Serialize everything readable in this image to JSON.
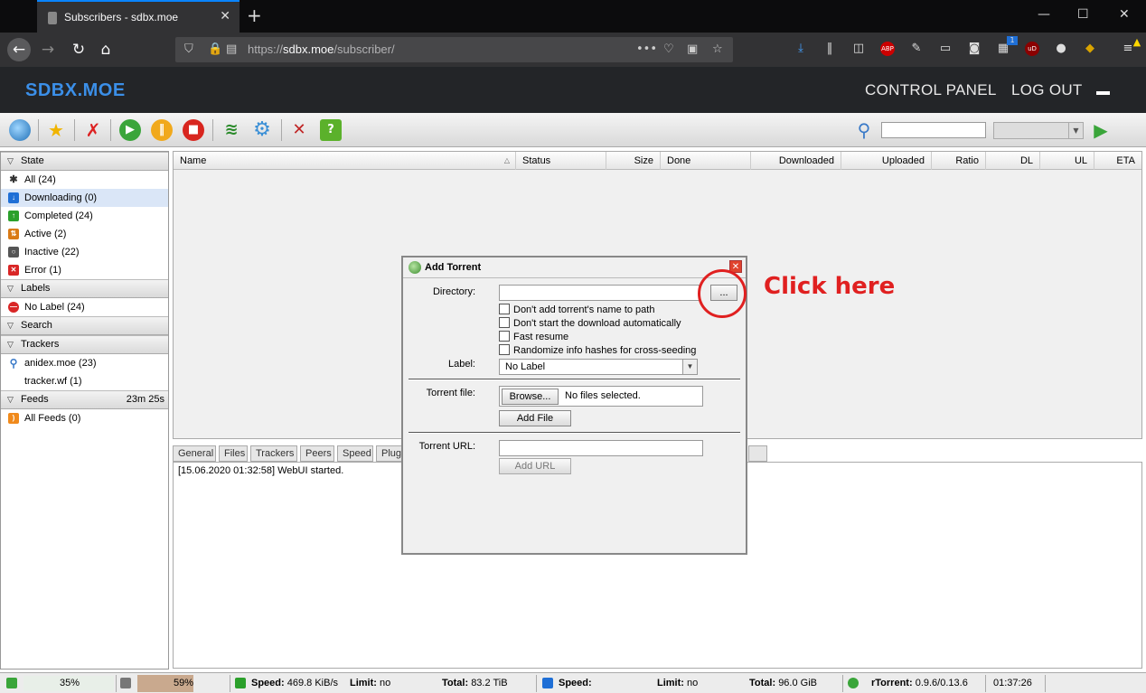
{
  "browser": {
    "tab_title": "Subscribers - sdbx.moe",
    "url_prefix": "https://",
    "url_host": "sdbx.moe",
    "url_path": "/subscriber/",
    "ext_badge": "1"
  },
  "site": {
    "logo": "SDBX.MOE",
    "nav": [
      "CONTROL PANEL",
      "LOG OUT"
    ]
  },
  "sidebar": {
    "state_header": "State",
    "state_items": [
      {
        "label": "All (24)",
        "icon": "all-icon",
        "color": "#333333"
      },
      {
        "label": "Downloading (0)",
        "icon": "download-arrow-icon",
        "color": "#1f6fd6"
      },
      {
        "label": "Completed (24)",
        "icon": "upload-arrow-icon",
        "color": "#2ba02b"
      },
      {
        "label": "Active (2)",
        "icon": "active-icon",
        "color": "#d97a16"
      },
      {
        "label": "Inactive (22)",
        "icon": "inactive-icon",
        "color": "#555555"
      },
      {
        "label": "Error (1)",
        "icon": "error-icon",
        "color": "#d92626"
      }
    ],
    "labels_header": "Labels",
    "label_items": [
      {
        "label": "No Label (24)"
      }
    ],
    "search_header": "Search",
    "trackers_header": "Trackers",
    "tracker_items": [
      {
        "label": "anidex.moe (23)"
      },
      {
        "label": "tracker.wf (1)"
      }
    ],
    "feeds_header": "Feeds",
    "feeds_time": "23m 25s",
    "feed_items": [
      {
        "label": "All Feeds (0)"
      }
    ]
  },
  "table": {
    "columns": [
      "Name",
      "Status",
      "Size",
      "Done",
      "Downloaded",
      "Uploaded",
      "Ratio",
      "DL",
      "UL",
      "ETA"
    ]
  },
  "bottom_tabs": [
    "General",
    "Files",
    "Trackers",
    "Peers",
    "Speed",
    "Plug"
  ],
  "log": [
    "[15.06.2020 01:32:58] WebUI started."
  ],
  "dialog": {
    "title": "Add Torrent",
    "directory_label": "Directory:",
    "browse_dots": "...",
    "checkboxes": [
      "Don't add torrent's name to path",
      "Don't start the download automatically",
      "Fast resume",
      "Randomize info hashes for cross-seeding"
    ],
    "label_label": "Label:",
    "label_value": "No Label",
    "torrent_file_label": "Torrent file:",
    "browse_button": "Browse...",
    "no_files": "No files selected.",
    "add_file_button": "Add File",
    "torrent_url_label": "Torrent URL:",
    "add_url_button": "Add URL"
  },
  "annotation": {
    "text": "Click here",
    "color": "#e02020"
  },
  "status": {
    "disk_pct": "35%",
    "mem_pct": "59%",
    "dl_speed_label": "Speed:",
    "dl_speed": "469.8 KiB/s",
    "dl_limit_label": "Limit:",
    "dl_limit": "no",
    "dl_total_label": "Total:",
    "dl_total": "83.2 TiB",
    "ul_speed_label": "Speed:",
    "ul_limit_label": "Limit:",
    "ul_limit": "no",
    "ul_total_label": "Total:",
    "ul_total": "96.0 GiB",
    "rtorrent_label": "rTorrent:",
    "rtorrent_version": "0.9.6/0.13.6",
    "time": "01:37:26"
  }
}
